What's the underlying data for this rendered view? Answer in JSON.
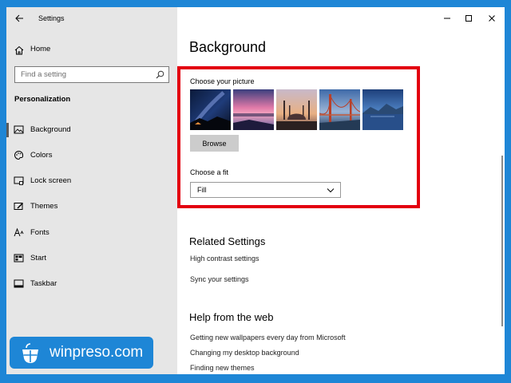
{
  "window": {
    "title": "Settings"
  },
  "sidebar": {
    "home_label": "Home",
    "search_placeholder": "Find a setting",
    "section_title": "Personalization",
    "items": [
      {
        "label": "Background",
        "icon": "picture-icon",
        "selected": true
      },
      {
        "label": "Colors",
        "icon": "palette-icon",
        "selected": false
      },
      {
        "label": "Lock screen",
        "icon": "lock-screen-icon",
        "selected": false
      },
      {
        "label": "Themes",
        "icon": "brush-icon",
        "selected": false
      },
      {
        "label": "Fonts",
        "icon": "font-icon",
        "selected": false
      },
      {
        "label": "Start",
        "icon": "start-menu-icon",
        "selected": false
      },
      {
        "label": "Taskbar",
        "icon": "taskbar-icon",
        "selected": false
      }
    ]
  },
  "main": {
    "page_title": "Background",
    "choose_picture_label": "Choose your picture",
    "pictures": [
      "milky-way-night",
      "pink-sunset-lake",
      "mosque-dusk",
      "golden-gate-bridge",
      "mountain-lake-blue"
    ],
    "browse_label": "Browse",
    "choose_fit_label": "Choose a fit",
    "fit_value": "Fill",
    "related_title": "Related Settings",
    "related_links": [
      "High contrast settings",
      "Sync your settings"
    ],
    "help_title": "Help from the web",
    "help_links": [
      "Getting new wallpapers every day from Microsoft",
      "Changing my desktop background",
      "Finding new themes"
    ]
  },
  "watermark": {
    "text": "winpreso.com"
  },
  "colors": {
    "accent_border": "#e3000f",
    "desktop_blue": "#1e86d6",
    "sidebar_bg": "#e6e6e6"
  }
}
